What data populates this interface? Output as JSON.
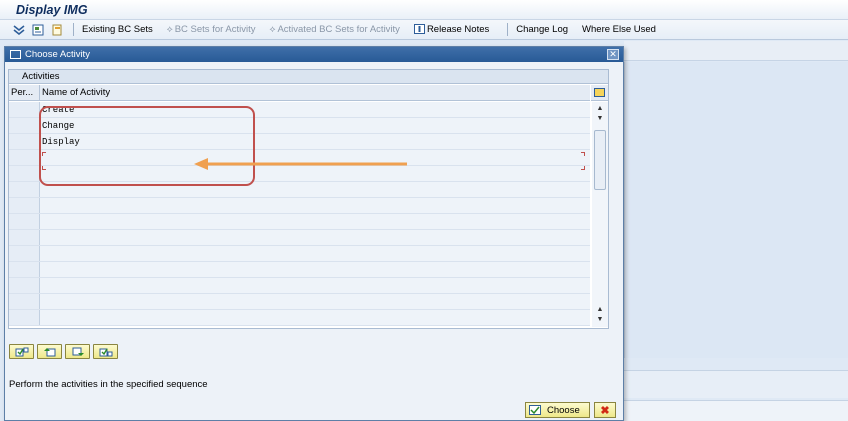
{
  "window": {
    "title": "Display IMG"
  },
  "toolbar": {
    "existing_bc_sets": "Existing BC Sets",
    "bc_sets_for_activity": "BC Sets for Activity",
    "activated_bc_sets": "Activated BC Sets for Activity",
    "release_notes": "Release Notes",
    "change_log": "Change Log",
    "where_else_used": "Where Else Used",
    "icons": [
      "expand-icon",
      "bc-set-icon",
      "document-icon"
    ]
  },
  "dialog": {
    "title": "Choose Activity",
    "close_label": "✕",
    "table": {
      "caption": "Activities",
      "columns": [
        "Per...",
        "Name of Activity"
      ],
      "rows": [
        {
          "per": "",
          "name": "Create"
        },
        {
          "per": "",
          "name": "Change"
        },
        {
          "per": "",
          "name": "Display"
        },
        {
          "per": "",
          "name": ""
        },
        {
          "per": "",
          "name": ""
        },
        {
          "per": "",
          "name": ""
        },
        {
          "per": "",
          "name": ""
        },
        {
          "per": "",
          "name": ""
        },
        {
          "per": "",
          "name": ""
        },
        {
          "per": "",
          "name": ""
        },
        {
          "per": "",
          "name": ""
        },
        {
          "per": "",
          "name": ""
        },
        {
          "per": "",
          "name": ""
        },
        {
          "per": "",
          "name": ""
        }
      ]
    },
    "icon_buttons": [
      "select-all-icon",
      "move-up-icon",
      "move-down-icon",
      "deselect-icon"
    ],
    "hint": "Perform the activities in the specified sequence",
    "choose_label": "Choose",
    "cancel_label": "✖"
  },
  "colors": {
    "annotation": "#c0504d",
    "arrow": "#f0a050",
    "dialog_title_bg": "#285a96",
    "button_yellow": "#eee88a"
  }
}
